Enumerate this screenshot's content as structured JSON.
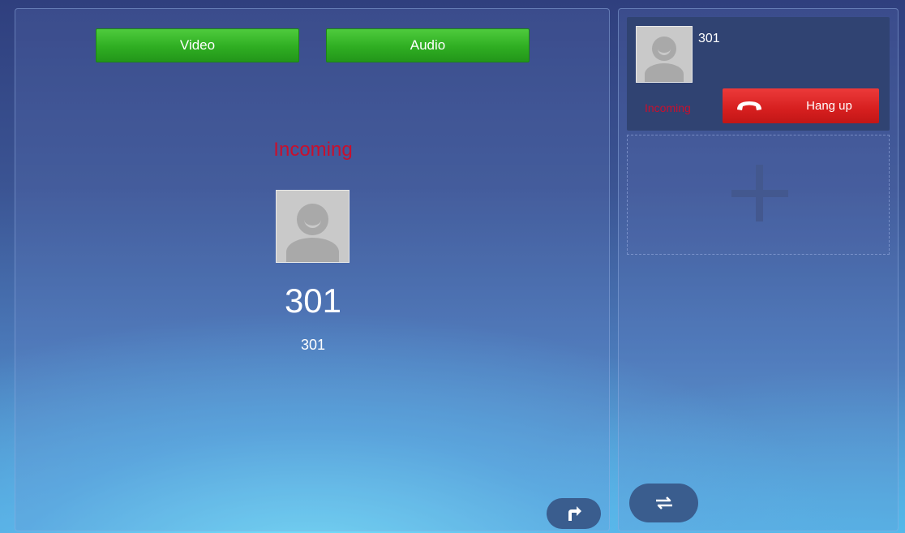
{
  "main": {
    "buttons": {
      "video_label": "Video",
      "audio_label": "Audio"
    },
    "status": "Incoming",
    "caller_name": "301",
    "caller_number": "301"
  },
  "side": {
    "call": {
      "name": "301",
      "status": "Incoming",
      "hangup_label": "Hang up"
    }
  },
  "icons": {
    "avatar": "person-placeholder-icon",
    "forward": "forward-arrow-icon",
    "swap": "swap-arrows-icon",
    "handset": "phone-handset-icon",
    "add": "plus-icon"
  },
  "colors": {
    "accept_green": "#2fae22",
    "hangup_red": "#d61f1f",
    "status_red": "#c8102e"
  }
}
